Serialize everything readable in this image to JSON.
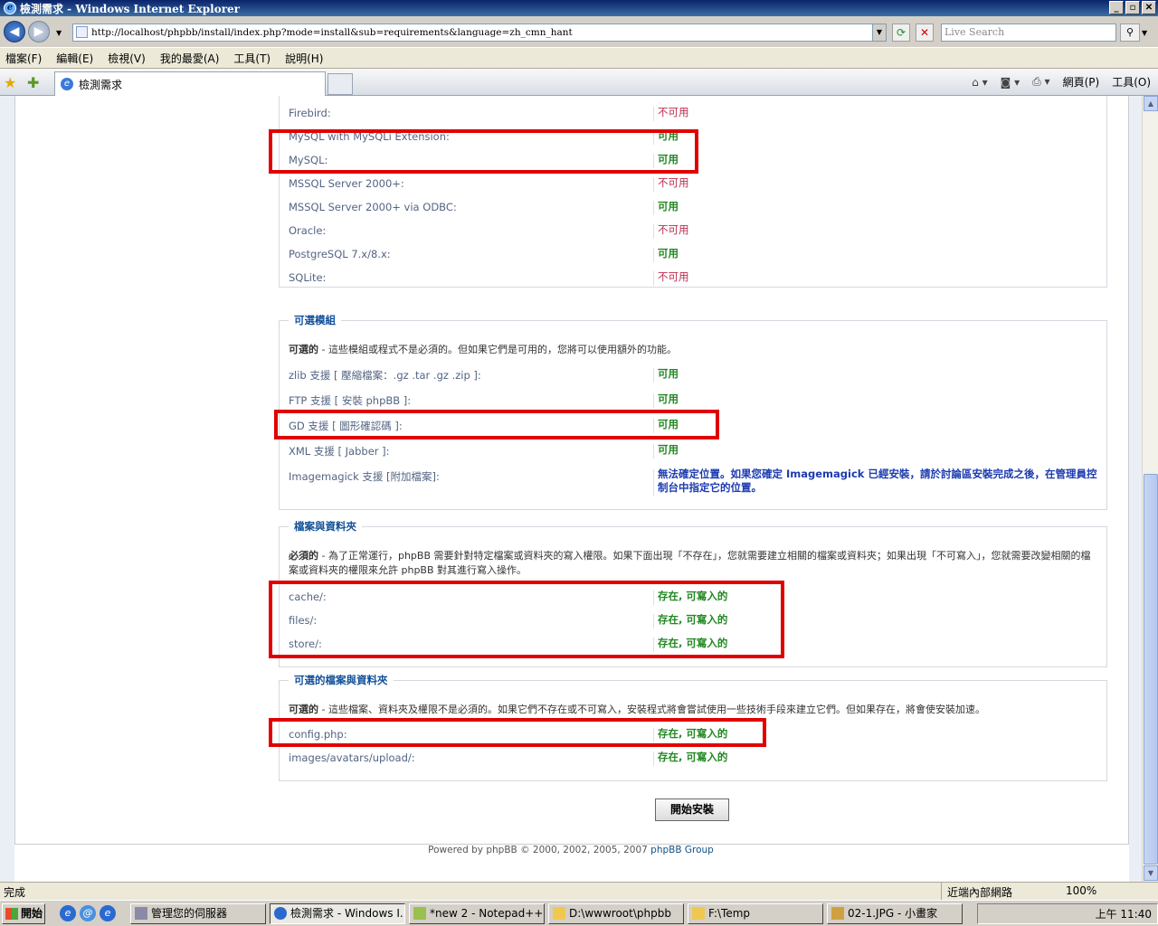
{
  "window": {
    "title": "檢測需求 - Windows Internet Explorer",
    "min": "_",
    "max": "▫",
    "close": "✕"
  },
  "address": {
    "url": "http://localhost/phpbb/install/index.php?mode=install&sub=requirements&language=zh_cmn_hant",
    "search_placeholder": "Live Search"
  },
  "menu": [
    "檔案(F)",
    "編輯(E)",
    "檢視(V)",
    "我的最愛(A)",
    "工具(T)",
    "說明(H)"
  ],
  "tab": {
    "label": "檢測需求"
  },
  "toolbar_right": {
    "page": "網頁(P)",
    "tools": "工具(O)"
  },
  "databases": {
    "rows": [
      {
        "label": "Firebird:",
        "value": "不可用",
        "status": "bad"
      },
      {
        "label": "MySQL with MySQLi Extension:",
        "value": "可用",
        "status": "ok"
      },
      {
        "label": "MySQL:",
        "value": "可用",
        "status": "ok"
      },
      {
        "label": "MSSQL Server 2000+:",
        "value": "不可用",
        "status": "bad"
      },
      {
        "label": "MSSQL Server 2000+ via ODBC:",
        "value": "可用",
        "status": "ok"
      },
      {
        "label": "Oracle:",
        "value": "不可用",
        "status": "bad"
      },
      {
        "label": "PostgreSQL 7.x/8.x:",
        "value": "可用",
        "status": "ok"
      },
      {
        "label": "SQLite:",
        "value": "不可用",
        "status": "bad"
      }
    ]
  },
  "optional_modules": {
    "legend": "可選模組",
    "desc_bold": "可選的",
    "desc": " - 這些模組或程式不是必須的。但如果它們是可用的，您將可以使用額外的功能。",
    "rows": [
      {
        "label": "zlib 支援 [ 壓縮檔案：.gz .tar .gz .zip ]:",
        "value": "可用"
      },
      {
        "label": "FTP 支援 [ 安裝 phpBB ]:",
        "value": "可用"
      },
      {
        "label": "GD 支援 [ 圖形確認碼 ]:",
        "value": "可用"
      },
      {
        "label": "XML 支援 [ Jabber ]:",
        "value": "可用"
      },
      {
        "label": "Imagemagick 支援 [附加檔案]:",
        "value": "無法確定位置。如果您確定 Imagemagick 已經安裝，請於討論區安裝完成之後，在管理員控制台中指定它的位置。"
      }
    ]
  },
  "files": {
    "legend": "檔案與資料夾",
    "desc_bold": "必須的",
    "desc": " - 為了正常運行，phpBB 需要針對特定檔案或資料夾的寫入權限。如果下面出現「不存在」，您就需要建立相關的檔案或資料夾；如果出現「不可寫入」，您就需要改變相關的檔案或資料夾的權限來允許 phpBB 對其進行寫入操作。",
    "rows": [
      {
        "label": "cache/:",
        "value": "存在, 可寫入的"
      },
      {
        "label": "files/:",
        "value": "存在, 可寫入的"
      },
      {
        "label": "store/:",
        "value": "存在, 可寫入的"
      }
    ]
  },
  "optional_files": {
    "legend": "可選的檔案與資料夾",
    "desc_bold": "可選的",
    "desc": " - 這些檔案、資料夾及權限不是必須的。如果它們不存在或不可寫入，安裝程式將會嘗試使用一些技術手段來建立它們。但如果存在，將會使安裝加速。",
    "rows": [
      {
        "label": "config.php:",
        "value": "存在, 可寫入的"
      },
      {
        "label": "images/avatars/upload/:",
        "value": "存在, 可寫入的"
      }
    ]
  },
  "install_button": "開始安裝",
  "footer": {
    "text": "Powered by phpBB © 2000, 2002, 2005, 2007 ",
    "group": "phpBB Group"
  },
  "status": {
    "text": "完成",
    "zone": "近端內部網路",
    "zoom": "100%"
  },
  "taskbar": {
    "start": "開始",
    "tasks": [
      "管理您的伺服器",
      "檢測需求 - Windows I...",
      "*new 2 - Notepad++",
      "D:\\wwwroot\\phpbb",
      "F:\\Temp",
      "02-1.JPG - 小畫家"
    ],
    "clock": "上午 11:40"
  },
  "colors": {
    "ok": "#228822",
    "bad": "#bc2a4d",
    "highlight": "#e00000",
    "legend": "#115098"
  }
}
